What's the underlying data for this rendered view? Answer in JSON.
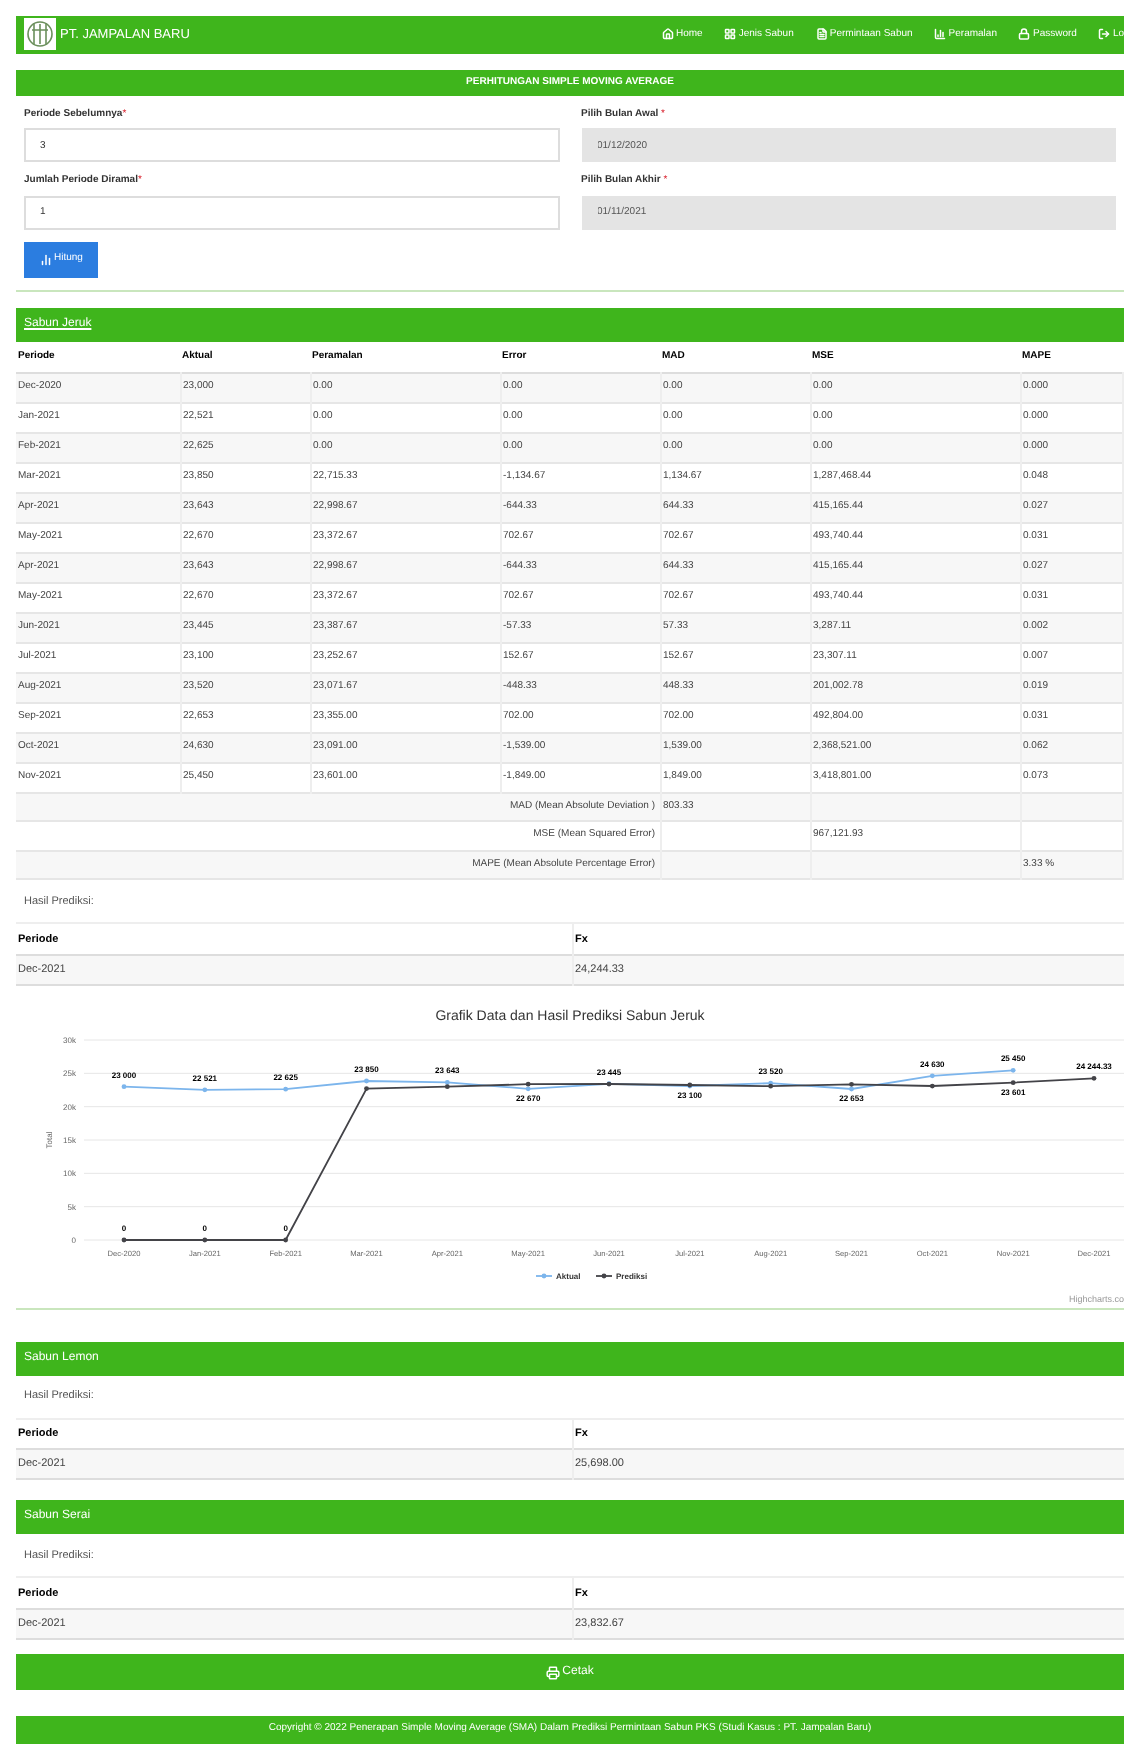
{
  "navbar": {
    "brand": "PT. JAMPALAN BARU",
    "menu": [
      {
        "label": "Home"
      },
      {
        "label": "Jenis Sabun"
      },
      {
        "label": "Permintaan Sabun"
      },
      {
        "label": "Peramalan"
      },
      {
        "label": "Password"
      },
      {
        "label": "Lo"
      }
    ]
  },
  "form": {
    "title": "PERHITUNGAN SIMPLE MOVING AVERAGE",
    "fields": [
      {
        "label": "Periode Sebelumnya",
        "required_mark": "*",
        "value": "3",
        "disabled": false
      },
      {
        "label": "Pilih Bulan Awal ",
        "required_mark": "*",
        "value": "01/12/2020",
        "disabled": true
      },
      {
        "label": "Jumlah Periode Diramal",
        "required_mark": "*",
        "value": "1",
        "disabled": false
      },
      {
        "label": "Pilih Bulan Akhir ",
        "required_mark": "*",
        "value": "01/11/2021",
        "disabled": true
      }
    ],
    "button": "Hitung"
  },
  "products": [
    {
      "title": "Sabun Jeruk",
      "link": true,
      "table": {
        "columns": [
          "Periode",
          "Aktual",
          "Peramalan",
          "Error",
          "MAD",
          "MSE",
          "MAPE"
        ],
        "rows": [
          [
            "Dec-2020",
            "23,000",
            "0.00",
            "0.00",
            "0.00",
            "0.00",
            "0.000"
          ],
          [
            "Jan-2021",
            "22,521",
            "0.00",
            "0.00",
            "0.00",
            "0.00",
            "0.000"
          ],
          [
            "Feb-2021",
            "22,625",
            "0.00",
            "0.00",
            "0.00",
            "0.00",
            "0.000"
          ],
          [
            "Mar-2021",
            "23,850",
            "22,715.33",
            "-1,134.67",
            "1,134.67",
            "1,287,468.44",
            "0.048"
          ],
          [
            "Apr-2021",
            "23,643",
            "22,998.67",
            "-644.33",
            "644.33",
            "415,165.44",
            "0.027"
          ],
          [
            "May-2021",
            "22,670",
            "23,372.67",
            "702.67",
            "702.67",
            "493,740.44",
            "0.031"
          ],
          [
            "Apr-2021",
            "23,643",
            "22,998.67",
            "-644.33",
            "644.33",
            "415,165.44",
            "0.027"
          ],
          [
            "May-2021",
            "22,670",
            "23,372.67",
            "702.67",
            "702.67",
            "493,740.44",
            "0.031"
          ],
          [
            "Jun-2021",
            "23,445",
            "23,387.67",
            "-57.33",
            "57.33",
            "3,287.11",
            "0.002"
          ],
          [
            "Jul-2021",
            "23,100",
            "23,252.67",
            "152.67",
            "152.67",
            "23,307.11",
            "0.007"
          ],
          [
            "Aug-2021",
            "23,520",
            "23,071.67",
            "-448.33",
            "448.33",
            "201,002.78",
            "0.019"
          ],
          [
            "Sep-2021",
            "22,653",
            "23,355.00",
            "702.00",
            "702.00",
            "492,804.00",
            "0.031"
          ],
          [
            "Oct-2021",
            "24,630",
            "23,091.00",
            "-1,539.00",
            "1,539.00",
            "2,368,521.00",
            "0.062"
          ],
          [
            "Nov-2021",
            "25,450",
            "23,601.00",
            "-1,849.00",
            "1,849.00",
            "3,418,801.00",
            "0.073"
          ]
        ],
        "summary": [
          {
            "label": "MAD (Mean Absolute Deviation )",
            "value": "803.33"
          },
          {
            "label": "MSE (Mean Squared Error)",
            "value": "967,121.93"
          },
          {
            "label": "MAPE (Mean Absolute Percentage Error)",
            "value": "3.33 %"
          }
        ]
      },
      "prediction": {
        "label": "Hasil Prediksi:",
        "columns": [
          "Periode",
          "Fx"
        ],
        "rows": [
          [
            "Dec-2021",
            "24,244.33"
          ]
        ]
      },
      "chart_data": {
        "type": "line",
        "title": "Grafik Data dan Hasil Prediksi Sabun Jeruk",
        "ylabel": "Total",
        "categories": [
          "Dec-2020",
          "Jan-2021",
          "Feb-2021",
          "Mar-2021",
          "Apr-2021",
          "May-2021",
          "Jun-2021",
          "Jul-2021",
          "Aug-2021",
          "Sep-2021",
          "Oct-2021",
          "Nov-2021",
          "Dec-2021"
        ],
        "ylim": [
          0,
          30000
        ],
        "grid": true,
        "legend": "bottom",
        "yticks": [
          {
            "value": 0,
            "label": "0"
          },
          {
            "value": 5000,
            "label": "5k"
          },
          {
            "value": 10000,
            "label": "10k"
          },
          {
            "value": 15000,
            "label": "15k"
          },
          {
            "value": 20000,
            "label": "20k"
          },
          {
            "value": 25000,
            "label": "25k"
          },
          {
            "value": 30000,
            "label": "30k"
          }
        ],
        "series": [
          {
            "name": "Aktual",
            "color": "#7cb5ec",
            "values": [
              23000,
              22521,
              22625,
              23850,
              23643,
              22670,
              23445,
              23100,
              23520,
              22653,
              24630,
              25450,
              null
            ],
            "value_labels": [
              "23 000",
              "22 521",
              "22 625",
              "23 850",
              "23 643",
              "22 670",
              "23 445",
              "23 100",
              "23 520",
              "22 653",
              "24 630",
              "25 450",
              null
            ]
          },
          {
            "name": "Prediksi",
            "color": "#434348",
            "values": [
              0,
              0,
              0,
              22715,
              22999,
              23373,
              23388,
              23253,
              23072,
              23355,
              23091,
              23601,
              24244.33
            ],
            "value_labels": [
              "0",
              "0",
              "0",
              null,
              null,
              null,
              null,
              null,
              null,
              null,
              null,
              "23 601",
              "24 244.33"
            ]
          }
        ]
      },
      "chart_credits": "Highcharts.co"
    },
    {
      "title": "Sabun Lemon",
      "link": false,
      "prediction": {
        "label": "Hasil Prediksi:",
        "columns": [
          "Periode",
          "Fx"
        ],
        "rows": [
          [
            "Dec-2021",
            "25,698.00"
          ]
        ]
      }
    },
    {
      "title": "Sabun Serai",
      "link": false,
      "prediction": {
        "label": "Hasil Prediksi:",
        "columns": [
          "Periode",
          "Fx"
        ],
        "rows": [
          [
            "Dec-2021",
            "23,832.67"
          ]
        ]
      }
    }
  ],
  "print_button": "Cetak",
  "footer": "Copyright © 2022 Penerapan Simple Moving Average (SMA) Dalam Prediksi Permintaan Sabun PKS (Studi Kasus : PT. Jampalan Baru)"
}
